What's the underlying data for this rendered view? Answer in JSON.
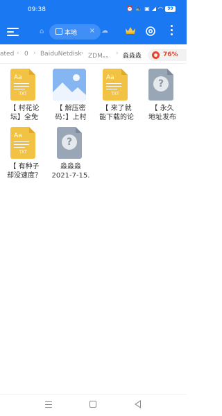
{
  "status_bar": {
    "time": "09:38",
    "battery": "99",
    "icons": [
      "alarm-icon",
      "volume-icon",
      "hd-icon",
      "signal-icon",
      "wifi-icon",
      "battery-icon"
    ]
  },
  "toolbar": {
    "tab_label": "本地",
    "tab_close": "×"
  },
  "breadcrumb": {
    "items": [
      "ated",
      "0",
      "BaiduNetdisk",
      "ZDM。。",
      "淼淼淼"
    ],
    "separator": "›"
  },
  "storage": {
    "percent_label": "76%",
    "percent": 76,
    "color": "#e8452c"
  },
  "files": [
    {
      "line1": "【 村花论",
      "line2": "坛】全免",
      "type": "txt",
      "ext": "TXT",
      "aa": "Aa"
    },
    {
      "line1": "【 解压密",
      "line2": "码：】上村",
      "type": "image"
    },
    {
      "line1": "【 来了就",
      "line2": "能下载的论",
      "type": "txt",
      "ext": "TXT",
      "aa": "Aa"
    },
    {
      "line1": "【 永久",
      "line2": "地址发布",
      "type": "unknown",
      "q": "?"
    },
    {
      "line1": "【 有种子",
      "line2": "却没速度？",
      "type": "txt",
      "ext": "TXT",
      "aa": "Aa"
    },
    {
      "line1": "淼淼淼",
      "line2": "2021-7-15.",
      "type": "unknown",
      "q": "?"
    }
  ],
  "colors": {
    "accent": "#1a78f2",
    "txt_icon": "#f2c244",
    "image_icon": "#86b6f2",
    "unknown_icon": "#99a6b6"
  }
}
